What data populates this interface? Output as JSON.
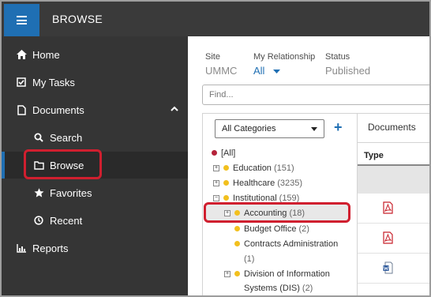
{
  "header": {
    "title": "BROWSE",
    "menu_icon": "hamburger-icon"
  },
  "sidebar": {
    "items": [
      {
        "label": "Home",
        "icon": "home-icon"
      },
      {
        "label": "My Tasks",
        "icon": "checkbox-icon"
      },
      {
        "label": "Documents",
        "icon": "document-icon"
      },
      {
        "label": "Search",
        "icon": "search-icon"
      },
      {
        "label": "Browse",
        "icon": "folder-icon"
      },
      {
        "label": "Favorites",
        "icon": "star-icon"
      },
      {
        "label": "Recent",
        "icon": "clock-icon"
      },
      {
        "label": "Reports",
        "icon": "bar-chart-icon"
      }
    ],
    "selected": "Browse"
  },
  "filters": {
    "site_label": "Site",
    "site_value": "UMMC",
    "relationship_label": "My Relationship",
    "relationship_value": "All",
    "status_label": "Status",
    "status_value": "Published"
  },
  "search": {
    "placeholder": "Find..."
  },
  "tree": {
    "category_select": "All Categories",
    "nodes": [
      {
        "label": "[All]",
        "count": "",
        "dot": "#b5233a"
      },
      {
        "label": "Education",
        "count": "(151)",
        "dot": "#f2c01e"
      },
      {
        "label": "Healthcare",
        "count": "(3235)",
        "dot": "#f2c01e"
      },
      {
        "label": "Institutional",
        "count": "(159)",
        "dot": "#f2c01e"
      },
      {
        "label": "Accounting",
        "count": "(18)",
        "dot": "#f2c01e"
      },
      {
        "label": "Budget Office",
        "count": "(2)",
        "dot": "#f2c01e"
      },
      {
        "label": "Contracts Administration",
        "count": "(1)",
        "dot": "#f2c01e"
      },
      {
        "label": "Division of Information",
        "count": "",
        "dot": "#f2c01e"
      },
      {
        "label": "Systems (DIS)",
        "count": "(2)",
        "dot": ""
      }
    ]
  },
  "documents": {
    "tab_label": "Documents",
    "type_header": "Type",
    "rows": [
      {
        "icon": "pdf-icon"
      },
      {
        "icon": "pdf-icon"
      },
      {
        "icon": "word-doc-icon"
      }
    ]
  },
  "colors": {
    "accent": "#1f6fb3",
    "highlight": "#d01f2f",
    "sidebar": "#353535"
  }
}
